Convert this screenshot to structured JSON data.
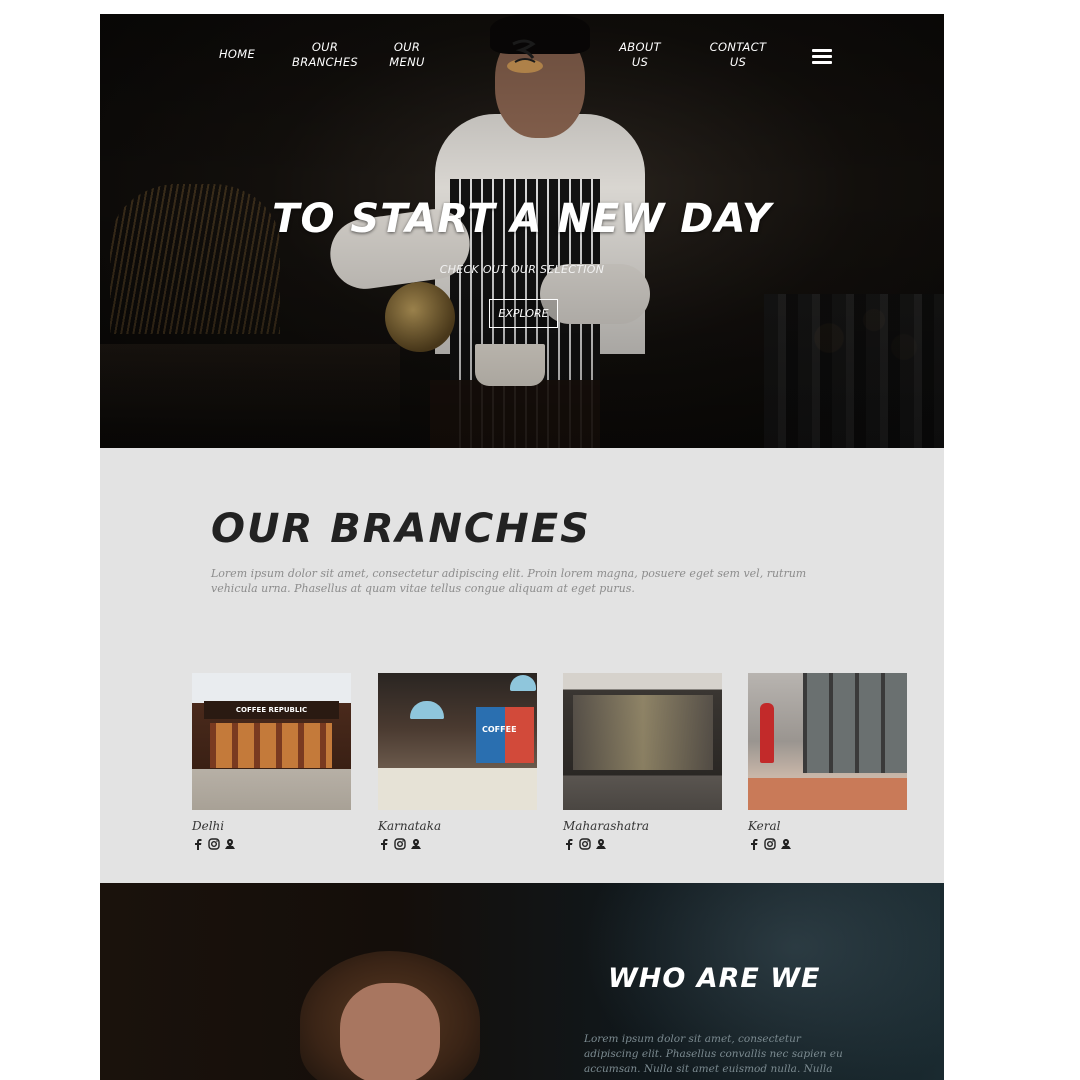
{
  "nav": {
    "home": "HOME",
    "branches_line1": "OUR",
    "branches_line2": "BRANCHES",
    "menu_line1": "OUR",
    "menu_line2": "MENU",
    "about_line1": "ABOUT",
    "about_line2": "US",
    "contact_line1": "CONTACT",
    "contact_line2": "US"
  },
  "hero": {
    "title": "TO START A NEW DAY",
    "subtitle": "CHECK OUT OUR SELECTION",
    "cta": "EXPLORE"
  },
  "branches": {
    "title": "OUR BRANCHES",
    "description": "Lorem ipsum dolor sit amet, consectetur adipiscing elit. Proin lorem magna, posuere eget sem vel, rutrum vehicula urna. Phasellus at quam vitae tellus congue aliquam at eget purus.",
    "items": [
      {
        "name": "Delhi",
        "sign": "COFFEE REPUBLIC"
      },
      {
        "name": "Karnataka",
        "sign": "COFFEE"
      },
      {
        "name": "Maharashatra"
      },
      {
        "name": "Keral"
      }
    ],
    "icons": [
      "facebook-icon",
      "instagram-icon",
      "map-icon"
    ]
  },
  "who": {
    "title": "WHO ARE WE",
    "text": "Lorem ipsum dolor sit amet, consectetur adipiscing elit. Phasellus convallis nec sapien eu accumsan. Nulla sit amet euismod nulla. Nulla"
  },
  "colors": {
    "hero_bg": "#0b0907",
    "section_bg": "#e3e3e3",
    "text_dark": "#222222",
    "muted": "#8c8c8c"
  }
}
